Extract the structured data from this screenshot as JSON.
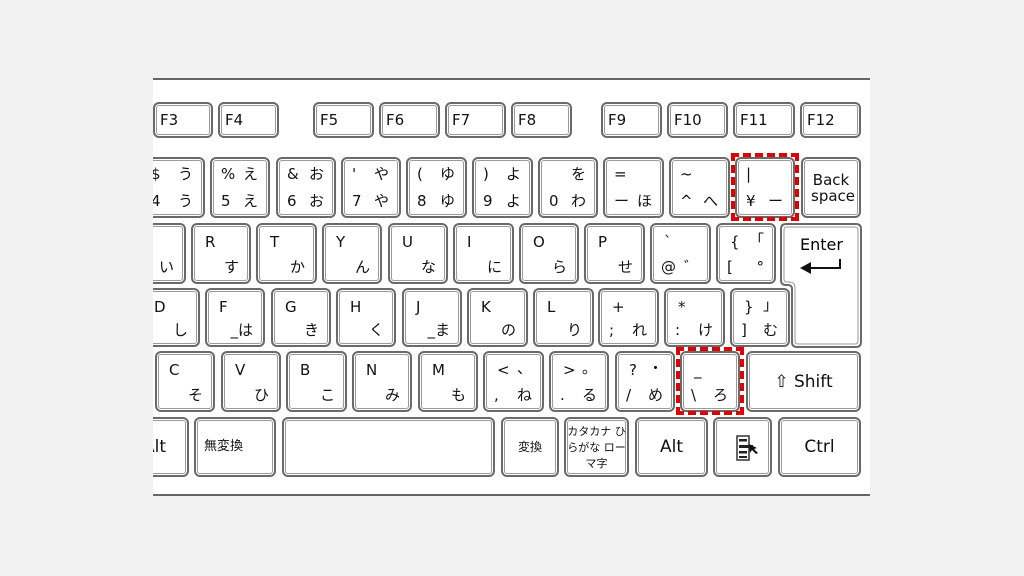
{
  "keyboard": {
    "function_row": [
      "F3",
      "F4",
      "F5",
      "F6",
      "F7",
      "F8",
      "F9",
      "F10",
      "F11",
      "F12"
    ],
    "number_row": [
      {
        "tl": "$",
        "tr": "う",
        "bl": "4",
        "br": "う"
      },
      {
        "tl": "%",
        "tr": "え",
        "bl": "5",
        "br": "え"
      },
      {
        "tl": "&",
        "tr": "お",
        "bl": "6",
        "br": "お"
      },
      {
        "tl": "'",
        "tr": "や",
        "bl": "7",
        "br": "や"
      },
      {
        "tl": "(",
        "tr": "ゆ",
        "bl": "8",
        "br": "ゆ"
      },
      {
        "tl": ")",
        "tr": "よ",
        "bl": "9",
        "br": "よ"
      },
      {
        "tl": "",
        "tr": "を",
        "bl": "0",
        "br": "わ"
      },
      {
        "tl": "=",
        "tr": "",
        "bl": "ー",
        "br": "ほ"
      },
      {
        "tl": "~",
        "tr": "",
        "bl": "^",
        "br": "へ"
      },
      {
        "tl": "|",
        "tr": "",
        "bl": "¥",
        "br": "ー"
      },
      {
        "ctr": "Back space"
      }
    ],
    "q_row": [
      {
        "tl": "",
        "br": "い"
      },
      {
        "tl": "R",
        "br": "す"
      },
      {
        "tl": "T",
        "br": "か"
      },
      {
        "tl": "Y",
        "br": "ん"
      },
      {
        "tl": "U",
        "br": "な"
      },
      {
        "tl": "I",
        "br": "に"
      },
      {
        "tl": "O",
        "br": "ら"
      },
      {
        "tl": "P",
        "br": "せ"
      },
      {
        "tl": "`",
        "bl": "@",
        "br": "゛"
      },
      {
        "tl": "{",
        "tr": "「",
        "bl": "[",
        "br": "°"
      }
    ],
    "enter": {
      "label": "Enter",
      "icon": "return-arrow-icon"
    },
    "a_row": [
      {
        "tl": "D",
        "br": "し"
      },
      {
        "tl": "F",
        "br": "_は"
      },
      {
        "tl": "G",
        "br": "き"
      },
      {
        "tl": "H",
        "br": "く"
      },
      {
        "tl": "J",
        "br": "_ま"
      },
      {
        "tl": "K",
        "br": "の"
      },
      {
        "tl": "L",
        "br": "り"
      },
      {
        "tl": "+",
        "bl": ";",
        "br": "れ"
      },
      {
        "tl": "*",
        "bl": ":",
        "br": "け"
      },
      {
        "tl": "}",
        "tr": "」",
        "bl": "]",
        "br": "む"
      }
    ],
    "z_row": [
      {
        "tl": "C",
        "br": "そ"
      },
      {
        "tl": "V",
        "br": "ひ"
      },
      {
        "tl": "B",
        "br": "こ"
      },
      {
        "tl": "N",
        "br": "み"
      },
      {
        "tl": "M",
        "br": "も"
      },
      {
        "tl": "<",
        "tr": "、",
        "bl": ",",
        "br": "ね"
      },
      {
        "tl": ">",
        "tr": "。",
        "bl": ".",
        "br": "る"
      },
      {
        "tl": "?",
        "tr": "・",
        "bl": "/",
        "br": "め"
      },
      {
        "tl": "_",
        "bl": "\\",
        "br": "ろ"
      },
      {
        "ctr": "⇧ Shift"
      }
    ],
    "bottom_row": [
      {
        "ctr": "Alt"
      },
      {
        "left": "無変換"
      },
      {
        "ctr": ""
      },
      {
        "ctrs": "変換"
      },
      {
        "kana3": "カタカナ ひらがな ローマ字"
      },
      {
        "ctr": "Alt"
      },
      {
        "icon": "application-menu-icon"
      },
      {
        "ctr": "Ctrl"
      }
    ],
    "highlight_color": "#e00000",
    "highlighted_keys": [
      "¥",
      "\\"
    ]
  }
}
